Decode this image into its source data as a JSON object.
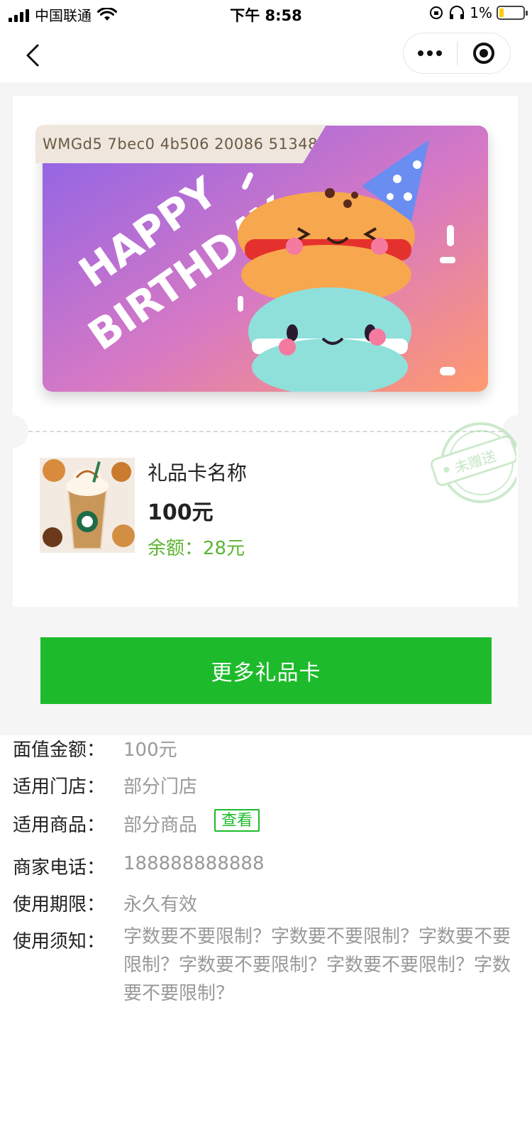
{
  "status_bar": {
    "carrier": "中国联通",
    "time": "下午 8:58",
    "battery": "1%",
    "battery_level": 0.01
  },
  "card": {
    "code": "WMGd5 7bec0 4b506 20086 51348",
    "image_text": "HAPPY BIRTHDAY",
    "name": "礼品卡名称",
    "value": "100元",
    "balance": "余额：28元",
    "stamp_text": "未赠送"
  },
  "more_button": "更多礼品卡",
  "details": {
    "face_value": {
      "label": "面值金额：",
      "value": "100元"
    },
    "stores": {
      "label": "适用门店：",
      "value": "部分门店"
    },
    "products": {
      "label": "适用商品：",
      "value": "部分商品",
      "link": "查看"
    },
    "phone": {
      "label": "商家电话：",
      "value": "188888888888"
    },
    "validity": {
      "label": "使用期限：",
      "value": "永久有效"
    },
    "notice": {
      "label": "使用须知：",
      "value": "字数要不要限制？字数要不要限制？字数要不要限制？字数要不要限制？字数要不要限制？字数要不要限制？"
    }
  },
  "colors": {
    "accent_green": "#1dbb2b",
    "balance_green": "#5cb531",
    "muted_text": "#999999",
    "page_gray": "#f5f5f5"
  },
  "icons": [
    "back-icon",
    "more-icon",
    "target-icon",
    "signal-icon",
    "wifi-icon",
    "battery-icon"
  ]
}
